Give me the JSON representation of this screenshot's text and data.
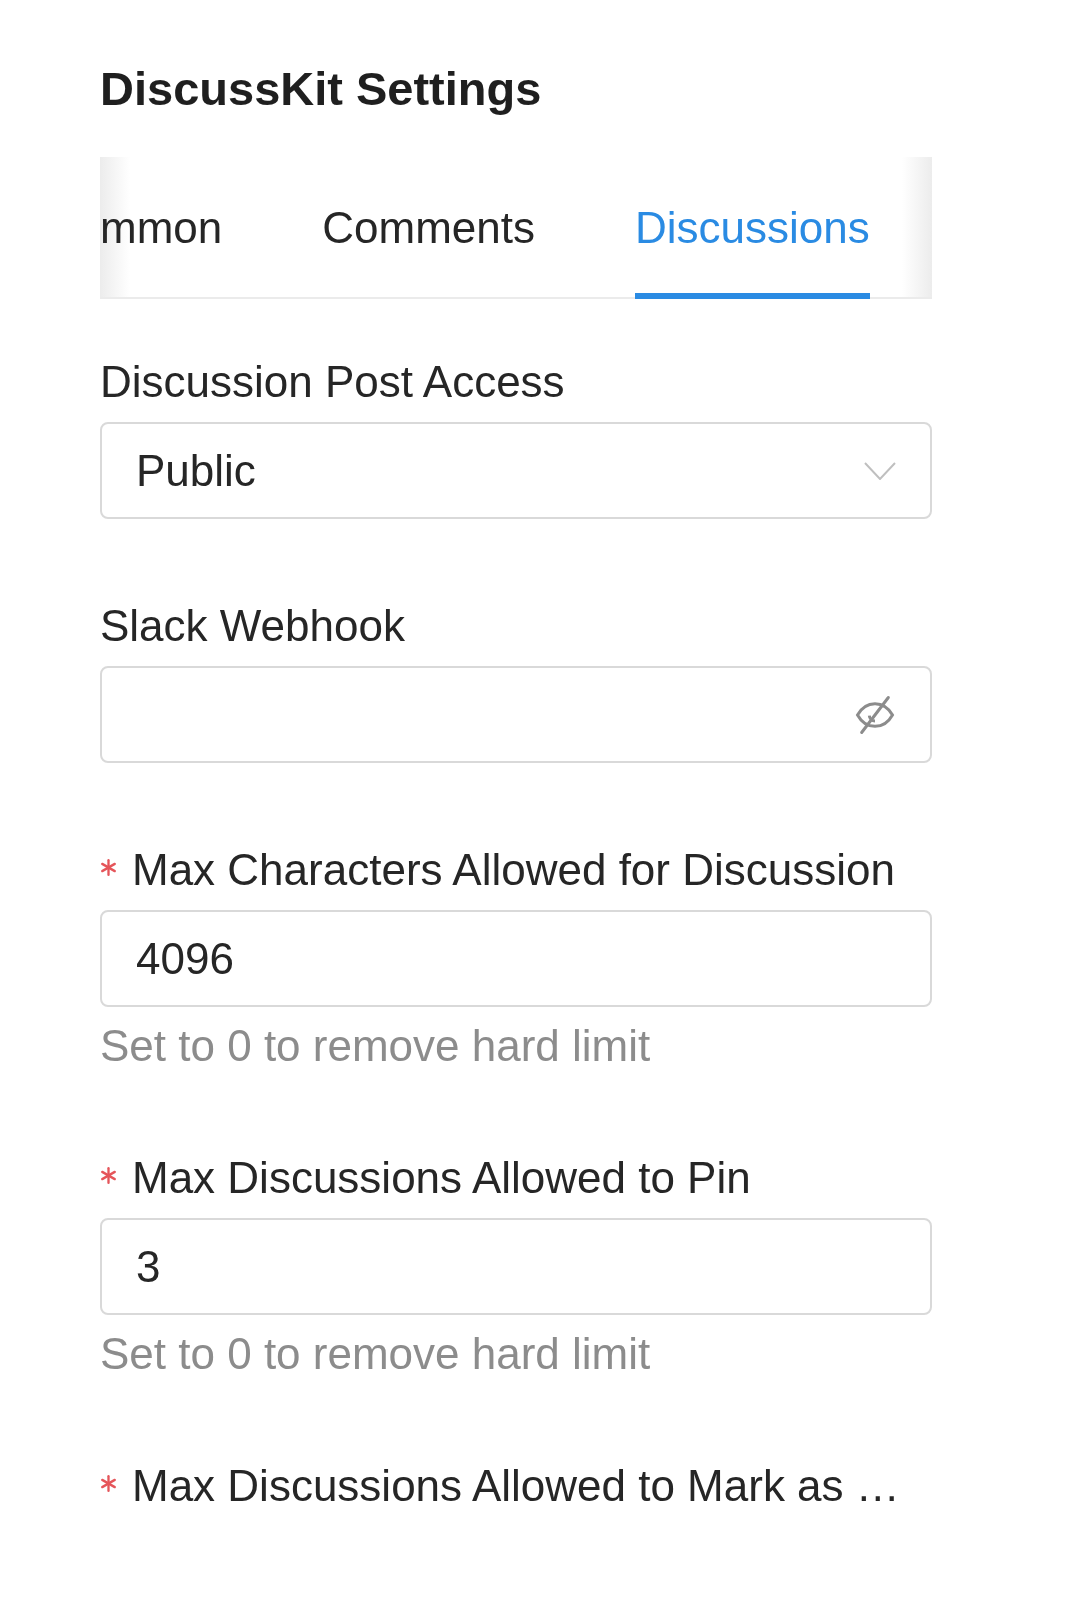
{
  "title": "DiscussKit Settings",
  "tabs": [
    {
      "label": "mmon",
      "selected": false
    },
    {
      "label": "Comments",
      "selected": false
    },
    {
      "label": "Discussions",
      "selected": true
    }
  ],
  "fields": [
    {
      "kind": "select",
      "label": "Discussion Post Access",
      "required": false,
      "value": "Public"
    },
    {
      "kind": "password",
      "label": "Slack Webhook",
      "required": false,
      "revealed": false
    },
    {
      "kind": "number",
      "label": "Max Characters Allowed for Discussion",
      "required": true,
      "value": "4096",
      "help": "Set to 0 to remove hard limit"
    },
    {
      "kind": "number",
      "label": "Max Discussions Allowed to Pin",
      "required": true,
      "value": "3",
      "help": "Set to 0 to remove hard limit"
    },
    {
      "kind": "label_only",
      "label": "Max Discussions Allowed to Mark as …",
      "required": true
    }
  ]
}
